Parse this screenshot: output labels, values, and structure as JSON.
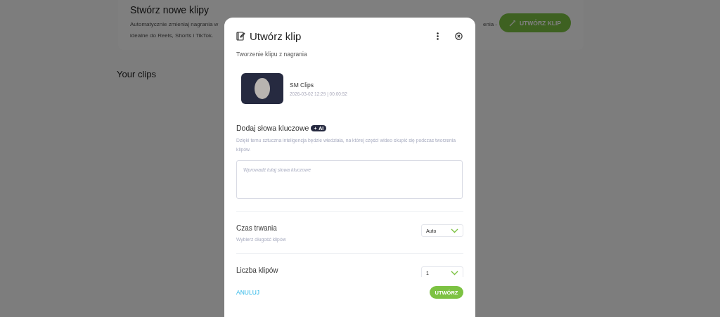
{
  "page": {
    "card": {
      "title": "Stwórz nowe klipy",
      "description_lines": [
        {
          "left": "Automatycznie zmieniaj nagrania w",
          "right": "enia -"
        },
        {
          "left": "idealne do Reels, Shorts i TikTok."
        }
      ],
      "button": "UTWÓRZ KLIP"
    },
    "section_title": "Your clips"
  },
  "dialog": {
    "title": "Utwórz klip",
    "subtitle": "Tworzenie klipu z nagrania",
    "recording": {
      "name": "SM Clips",
      "meta": "2026-03-02 12:29 | 00:00:52"
    },
    "keywords": {
      "label": "Dodaj słowa kluczowe",
      "badge": "AI",
      "help": "Dzięki temu sztuczna inteligencja będzie wiedziała, na której części wideo skupić się podczas tworzenia klipów.",
      "placeholder": "Wprowadź tutaj słowa kluczowe"
    },
    "settings": [
      {
        "label": "Czas trwania",
        "hint": "Wybierz długość klipów",
        "value": "Auto"
      },
      {
        "label": "Liczba klipów",
        "value": "1"
      }
    ],
    "cancel": "ANULUJ",
    "submit": "UTWÓRZ"
  }
}
